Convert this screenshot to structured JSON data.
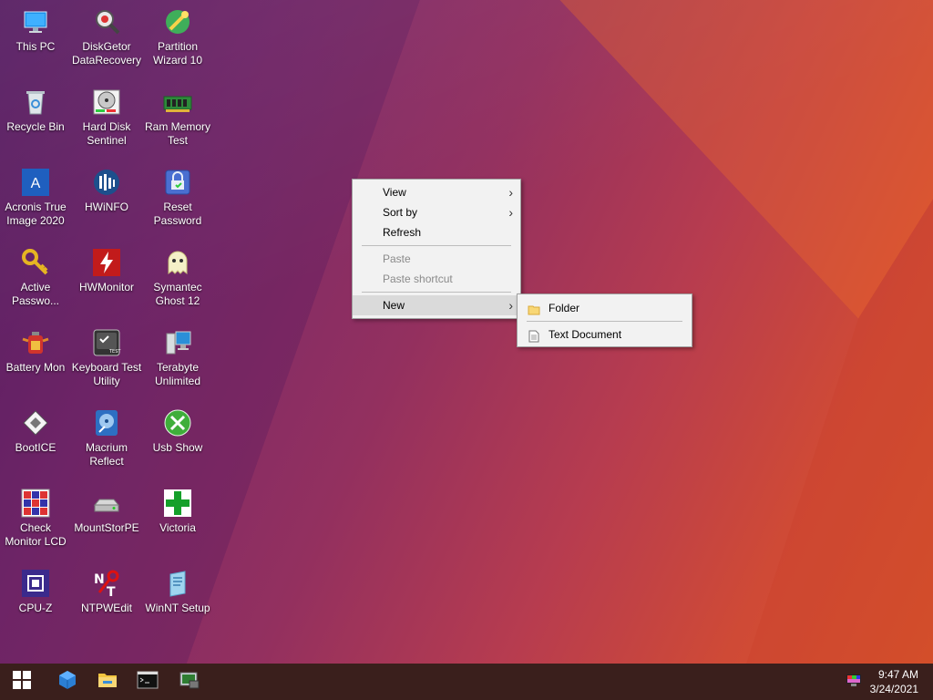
{
  "desktop": {
    "icons": [
      {
        "label": "This PC"
      },
      {
        "label": "DiskGetor\nDataRecovery"
      },
      {
        "label": "Partition\nWizard 10"
      },
      {
        "label": "Recycle Bin"
      },
      {
        "label": "Hard Disk\nSentinel"
      },
      {
        "label": "Ram Memory\nTest"
      },
      {
        "label": "Acronis True\nImage 2020"
      },
      {
        "label": "HWiNFO"
      },
      {
        "label": "Reset\nPassword"
      },
      {
        "label": "Active\nPasswo..."
      },
      {
        "label": "HWMonitor"
      },
      {
        "label": "Symantec\nGhost 12"
      },
      {
        "label": "Battery Mon"
      },
      {
        "label": "Keyboard Test\nUtility"
      },
      {
        "label": "Terabyte\nUnlimited"
      },
      {
        "label": "BootICE"
      },
      {
        "label": "Macrium\nReflect"
      },
      {
        "label": "Usb Show"
      },
      {
        "label": "Check\nMonitor LCD"
      },
      {
        "label": "MountStorPE"
      },
      {
        "label": "Victoria"
      },
      {
        "label": "CPU-Z"
      },
      {
        "label": "NTPWEdit"
      },
      {
        "label": "WinNT Setup"
      }
    ]
  },
  "context_menu": {
    "items": [
      {
        "label": "View"
      },
      {
        "label": "Sort by"
      },
      {
        "label": "Refresh"
      },
      {
        "label": "Paste"
      },
      {
        "label": "Paste shortcut"
      },
      {
        "label": "New"
      }
    ],
    "submenu": {
      "items": [
        {
          "label": "Folder"
        },
        {
          "label": "Text Document"
        }
      ]
    }
  },
  "taskbar": {
    "time": "9:47 AM",
    "date": "3/24/2021"
  },
  "colors": {
    "taskbar_bg": "#3a1f1c",
    "menu_bg": "#f2f2f2",
    "menu_highlight": "#dadada",
    "folder_yellow": "#f8d775"
  }
}
